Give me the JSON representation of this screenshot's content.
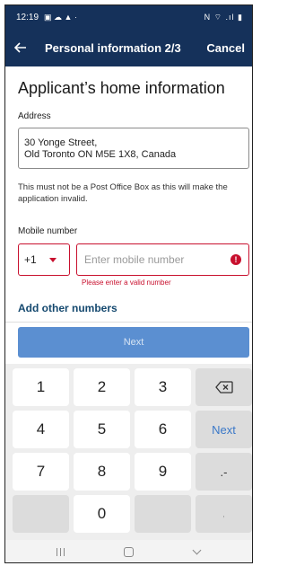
{
  "status_bar": {
    "time": "12:19",
    "left_icons": "▣ ☁ ▲ ·",
    "right_icons": "N ⌔ .ıl ▮"
  },
  "app_bar": {
    "title": "Personal information 2/3",
    "cancel_label": "Cancel",
    "back_icon": "arrow-left-icon"
  },
  "form": {
    "heading": "Applicant’s home information",
    "address": {
      "label": "Address",
      "value": "30 Yonge Street,\nOld Toronto ON M5E 1X8, Canada",
      "note": "This must not be a Post Office Box as this will make the application invalid."
    },
    "mobile": {
      "label": "Mobile number",
      "country_code": "+1",
      "placeholder": "Enter mobile number",
      "value": "",
      "error_icon": "!",
      "error_text": "Please enter a valid number"
    },
    "add_other_label": "Add other numbers",
    "next_label": "Next"
  },
  "keypad": {
    "keys": [
      "1",
      "2",
      "3",
      "backspace",
      "4",
      "5",
      "6",
      "Next",
      "7",
      "8",
      "9",
      ".-",
      "",
      "0",
      "",
      ","
    ],
    "next_color": "#3a78c8"
  },
  "colors": {
    "app_bar": "#15315a",
    "error": "#c8102e",
    "link": "#15496f",
    "button": "#5b8fd1"
  }
}
